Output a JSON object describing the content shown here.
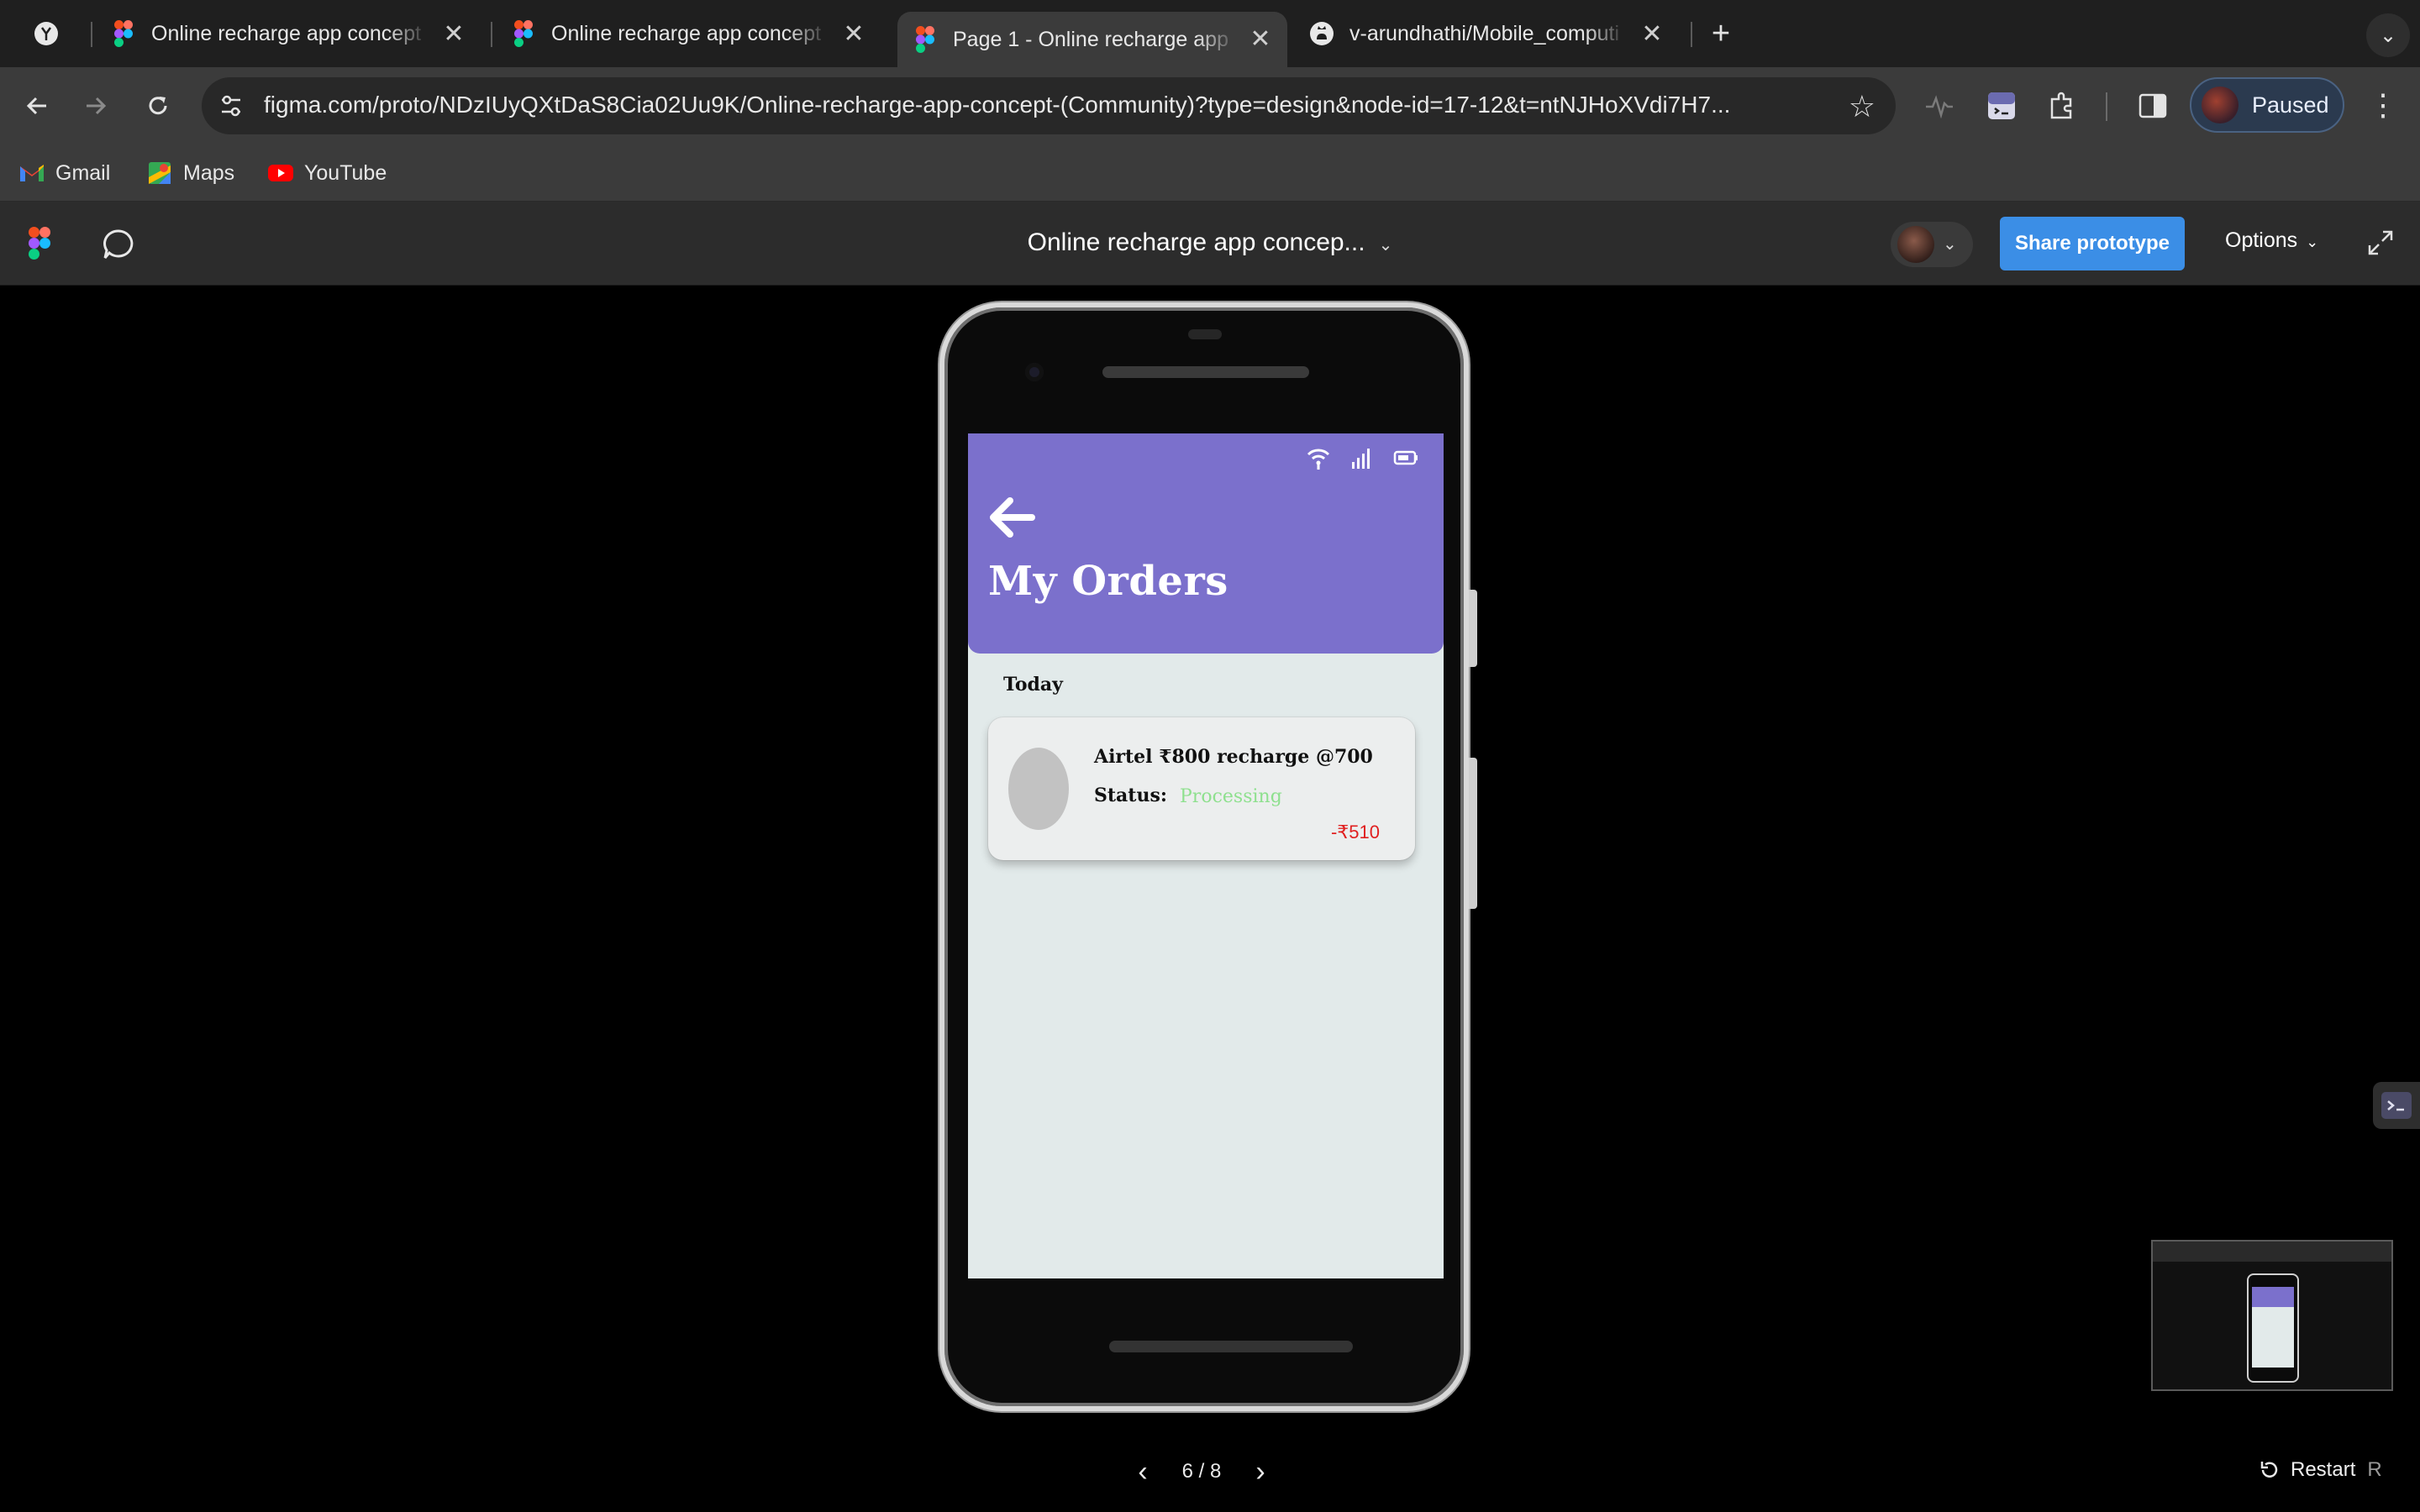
{
  "browser": {
    "tabs": [
      {
        "title": "",
        "favicon": "perplexity-icon"
      },
      {
        "title": "Online recharge app concept",
        "favicon": "figma-icon"
      },
      {
        "title": "Online recharge app concept",
        "favicon": "figma-icon"
      },
      {
        "title": "Page 1 - Online recharge app",
        "favicon": "figma-icon",
        "active": true
      },
      {
        "title": "v-arundhathi/Mobile_computi",
        "favicon": "github-icon"
      }
    ],
    "url": "figma.com/proto/NDzIUyQXtDaS8Cia02Uu9K/Online-recharge-app-concept-(Community)?type=design&node-id=17-12&t=ntNJHoXVdi7H7...",
    "profile_label": "Paused",
    "bookmarks": [
      {
        "label": "Gmail",
        "icon": "gmail-icon"
      },
      {
        "label": "Maps",
        "icon": "maps-icon"
      },
      {
        "label": "YouTube",
        "icon": "youtube-icon"
      }
    ]
  },
  "figma": {
    "file_title": "Online recharge app concep...",
    "share_label": "Share prototype",
    "options_label": "Options",
    "share_color": "#3b8ee6"
  },
  "app": {
    "header_color": "#7b70cc",
    "title": "My Orders",
    "section": "Today",
    "orders": [
      {
        "name": "Airtel ₹800 recharge @700",
        "status_label": "Status:",
        "status_value": "Processing",
        "status_color": "#8ee08e",
        "amount": "-₹510",
        "amount_color": "#e02020"
      }
    ]
  },
  "controls": {
    "page_indicator": "6 / 8",
    "restart_label": "Restart",
    "restart_key": "R"
  }
}
